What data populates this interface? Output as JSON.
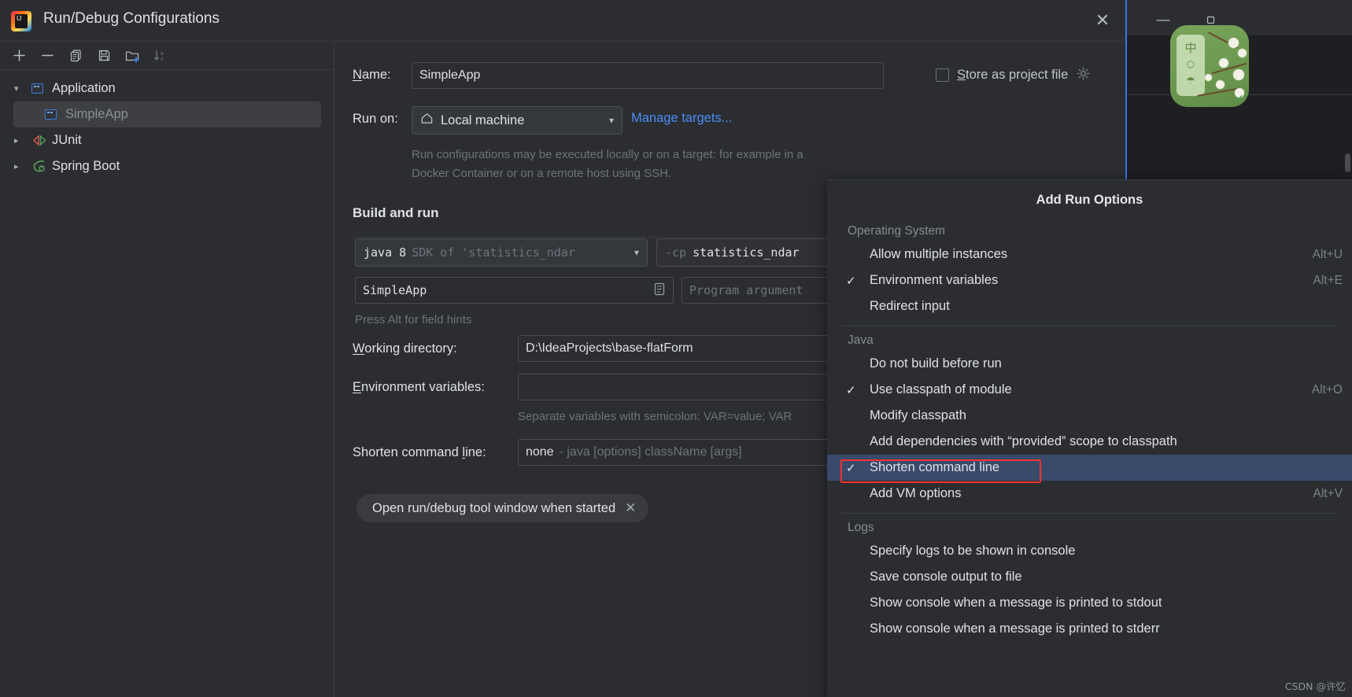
{
  "window": {
    "title": "Run/Debug Configurations",
    "close_icon": "close-icon",
    "logo_text": "IJ",
    "minimize_icon": "minimize-icon",
    "maximize_icon": "maximize-icon"
  },
  "toolbar": {
    "add": "add-icon",
    "remove": "remove-icon",
    "copy": "copy-icon",
    "save": "save-icon",
    "folder": "new-folder-icon",
    "sort": "sort-alphabetically-icon"
  },
  "tree": {
    "items": [
      {
        "label": "Application",
        "level": 0,
        "expanded": true,
        "arrow": "⌄",
        "icon": "application-icon",
        "selected": false
      },
      {
        "label": "SimpleApp",
        "level": 1,
        "expanded": false,
        "arrow": "",
        "icon": "application-icon",
        "selected": true
      },
      {
        "label": "JUnit",
        "level": 0,
        "expanded": false,
        "arrow": "›",
        "icon": "junit-icon",
        "selected": false
      },
      {
        "label": "Spring Boot",
        "level": 0,
        "expanded": false,
        "arrow": "›",
        "icon": "spring-boot-icon",
        "selected": false
      }
    ]
  },
  "form": {
    "name_label": "Name:",
    "name_label_mnemonic": "N",
    "name_value": "SimpleApp",
    "store_as_project_file": "Store as project file",
    "store_as_project_file_mnemonic": "S",
    "store_checked": false,
    "gear_icon": "gear-icon",
    "run_on_label": "Run on:",
    "run_on_value": "Local machine",
    "run_on_icon": "home-icon",
    "manage_targets": "Manage targets...",
    "run_on_description": "Run configurations may be executed locally or on a target: for example in a Docker Container or on a remote host using SSH.",
    "build_and_run": "Build and run",
    "jdk_value": "java 8",
    "jdk_secondary": "SDK of 'statistics_ndar",
    "cp_value": "-cp",
    "cp_secondary": "statistics_ndar",
    "main_class_value": "SimpleApp",
    "main_class_button_icon": "browse-class-icon",
    "program_arguments_placeholder": "Program argument",
    "press_alt_hint": "Press Alt for field hints",
    "working_directory_label": "Working directory:",
    "working_directory_mnemonic": "W",
    "working_directory_value": "D:\\IdeaProjects\\base-flatForm",
    "environment_variables_label": "Environment variables:",
    "environment_variables_mnemonic": "E",
    "environment_variables_value": "",
    "environment_variables_hint": "Separate variables with semicolon: VAR=value; VAR",
    "shorten_command_line_label": "Shorten command line:",
    "shorten_command_line_mnemonic": "l",
    "shorten_command_line_value": "none",
    "shorten_command_line_detail": "- java [options] className [args]",
    "chip_label": "Open run/debug tool window when started",
    "chip_close_icon": "close-icon"
  },
  "popup": {
    "title": "Add Run Options",
    "groups": [
      {
        "label": "Operating System",
        "items": [
          {
            "label": "Allow multiple instances",
            "checked": false,
            "accel": "Alt+U",
            "selected": false
          },
          {
            "label": "Environment variables",
            "checked": true,
            "accel": "Alt+E",
            "selected": false
          },
          {
            "label": "Redirect input",
            "checked": false,
            "accel": "",
            "selected": false
          }
        ]
      },
      {
        "label": "Java",
        "items": [
          {
            "label": "Do not build before run",
            "checked": false,
            "accel": "",
            "selected": false
          },
          {
            "label": "Use classpath of module",
            "checked": true,
            "accel": "Alt+O",
            "selected": false
          },
          {
            "label": "Modify classpath",
            "checked": false,
            "accel": "",
            "selected": false
          },
          {
            "label": "Add dependencies with “provided” scope to classpath",
            "checked": false,
            "accel": "",
            "selected": false
          },
          {
            "label": "Shorten command line",
            "checked": true,
            "accel": "",
            "selected": true
          },
          {
            "label": "Add VM options",
            "checked": false,
            "accel": "Alt+V",
            "selected": false
          }
        ]
      },
      {
        "label": "Logs",
        "items": [
          {
            "label": "Specify logs to be shown in console",
            "checked": false,
            "accel": "",
            "selected": false
          },
          {
            "label": "Save console output to file",
            "checked": false,
            "accel": "",
            "selected": false
          },
          {
            "label": "Show console when a message is printed to stdout",
            "checked": false,
            "accel": "",
            "selected": false
          },
          {
            "label": "Show console when a message is printed to stderr",
            "checked": false,
            "accel": "",
            "selected": false
          }
        ]
      }
    ],
    "check_glyph": "✓"
  },
  "badge": {
    "char1": "中",
    "char2": "○",
    "char3": "☂"
  },
  "watermark": "CSDN @许忆",
  "colors": {
    "accent_blue": "#3574f0",
    "link_blue": "#4a8df8",
    "selection": "#3a4a6b",
    "highlight_red": "#f1322f",
    "dialog_bg": "#2b2d30"
  }
}
